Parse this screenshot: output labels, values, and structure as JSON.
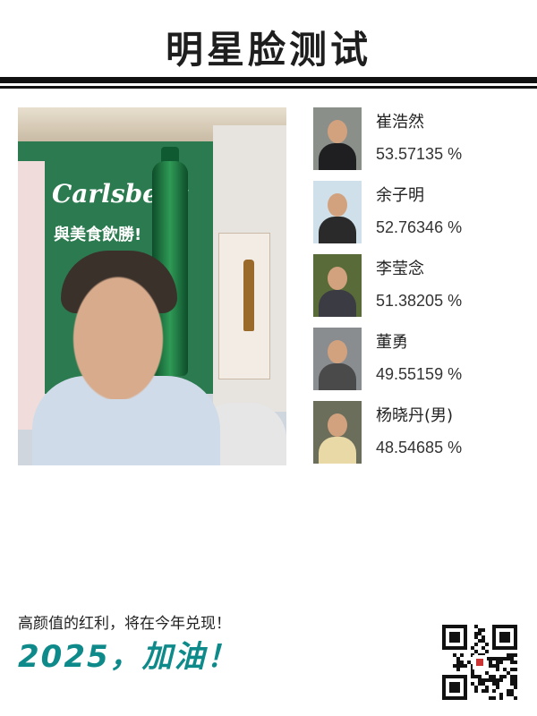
{
  "title": "明星脸测试",
  "matches": [
    {
      "name": "崔浩然",
      "score": "53.57135 %",
      "colors": {
        "bg": "#8a8f8a",
        "torso": "#1f1f22"
      }
    },
    {
      "name": "余子明",
      "score": "52.76346 %",
      "colors": {
        "bg": "#cfe0ea",
        "torso": "#2a2a2a"
      }
    },
    {
      "name": "李莹念",
      "score": "51.38205 %",
      "colors": {
        "bg": "#5a6b3a",
        "torso": "#3b3b44"
      }
    },
    {
      "name": "董勇",
      "score": "49.55159 %",
      "colors": {
        "bg": "#8a8d90",
        "torso": "#4a4a4a"
      }
    },
    {
      "name": "杨晓丹(男)",
      "score": "48.54685 %",
      "colors": {
        "bg": "#6b6e5a",
        "torso": "#e8d9a6"
      }
    }
  ],
  "caption": "高颜值的红利，将在今年兑现！",
  "slogan": "2025，加油！",
  "main_photo": {
    "brand_text": "Carlsberg",
    "poster_text": "與美食飲勝!"
  },
  "accent_color": "#0f8a8a"
}
